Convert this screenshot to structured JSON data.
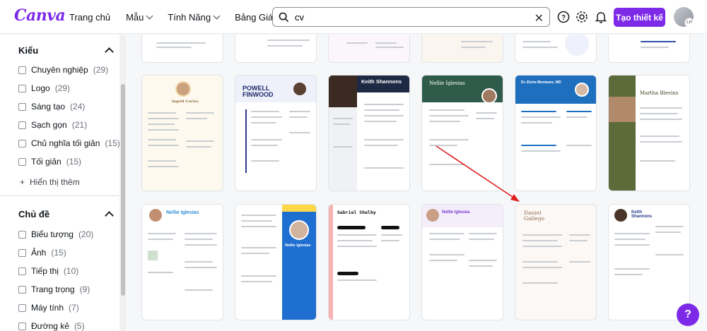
{
  "header": {
    "logo": "Canva",
    "nav": [
      {
        "label": "Trang chủ",
        "dropdown": false
      },
      {
        "label": "Mẫu",
        "dropdown": true
      },
      {
        "label": "Tính Năng",
        "dropdown": true
      },
      {
        "label": "Bảng Giá",
        "dropdown": true
      }
    ],
    "search_value": "cv",
    "create_button": "Tạo thiết kế",
    "avatar_initials": "LH"
  },
  "sidebar": {
    "section1_title": "Kiểu",
    "section1_items": [
      {
        "label": "Chuyên nghiệp",
        "count": "(29)"
      },
      {
        "label": "Logo",
        "count": "(29)"
      },
      {
        "label": "Sáng tạo",
        "count": "(24)"
      },
      {
        "label": "Sạch gọn",
        "count": "(21)"
      },
      {
        "label": "Chủ nghĩa tối giản",
        "count": "(15)"
      },
      {
        "label": "Tối giản",
        "count": "(15)"
      }
    ],
    "show_more": "Hiển thị thêm",
    "section2_title": "Chủ đề",
    "section2_items": [
      {
        "label": "Biểu tượng",
        "count": "(20)"
      },
      {
        "label": "Ảnh",
        "count": "(15)"
      },
      {
        "label": "Tiếp thị",
        "count": "(10)"
      },
      {
        "label": "Trang trọng",
        "count": "(9)"
      },
      {
        "label": "Máy tính",
        "count": "(7)"
      },
      {
        "label": "Đường kẻ",
        "count": "(5)"
      }
    ]
  },
  "templates": {
    "row2": [
      {
        "name": "Ingrid Cortez",
        "accent": "#f4d8a8"
      },
      {
        "name": "POWELL FINWOOD",
        "accent": "#2f3a8f"
      },
      {
        "name": "Keith Shannons",
        "accent": "#1e2a44"
      },
      {
        "name": "Nellie Iglesias",
        "accent": "#2f5b4a"
      },
      {
        "name": "Dr. Elvira Montanez, MD",
        "accent": "#1f6fbf"
      },
      {
        "name": "Martha Blevins",
        "accent": "#5b6b3a"
      }
    ],
    "row3": [
      {
        "name": "Nellie Iglesias",
        "accent": "#2f8fd8"
      },
      {
        "name": "Nellie Iglesias",
        "accent": "#1f6fd1"
      },
      {
        "name": "Gabriel Shelby",
        "accent": "#111111"
      },
      {
        "name": "Nellie Iglesias",
        "accent": "#7d3bd1"
      },
      {
        "name": "Daniel Gallego",
        "accent": "#9a6a4f"
      },
      {
        "name": "Keith Shannons",
        "accent": "#233a8a"
      }
    ]
  },
  "help_label": "?"
}
